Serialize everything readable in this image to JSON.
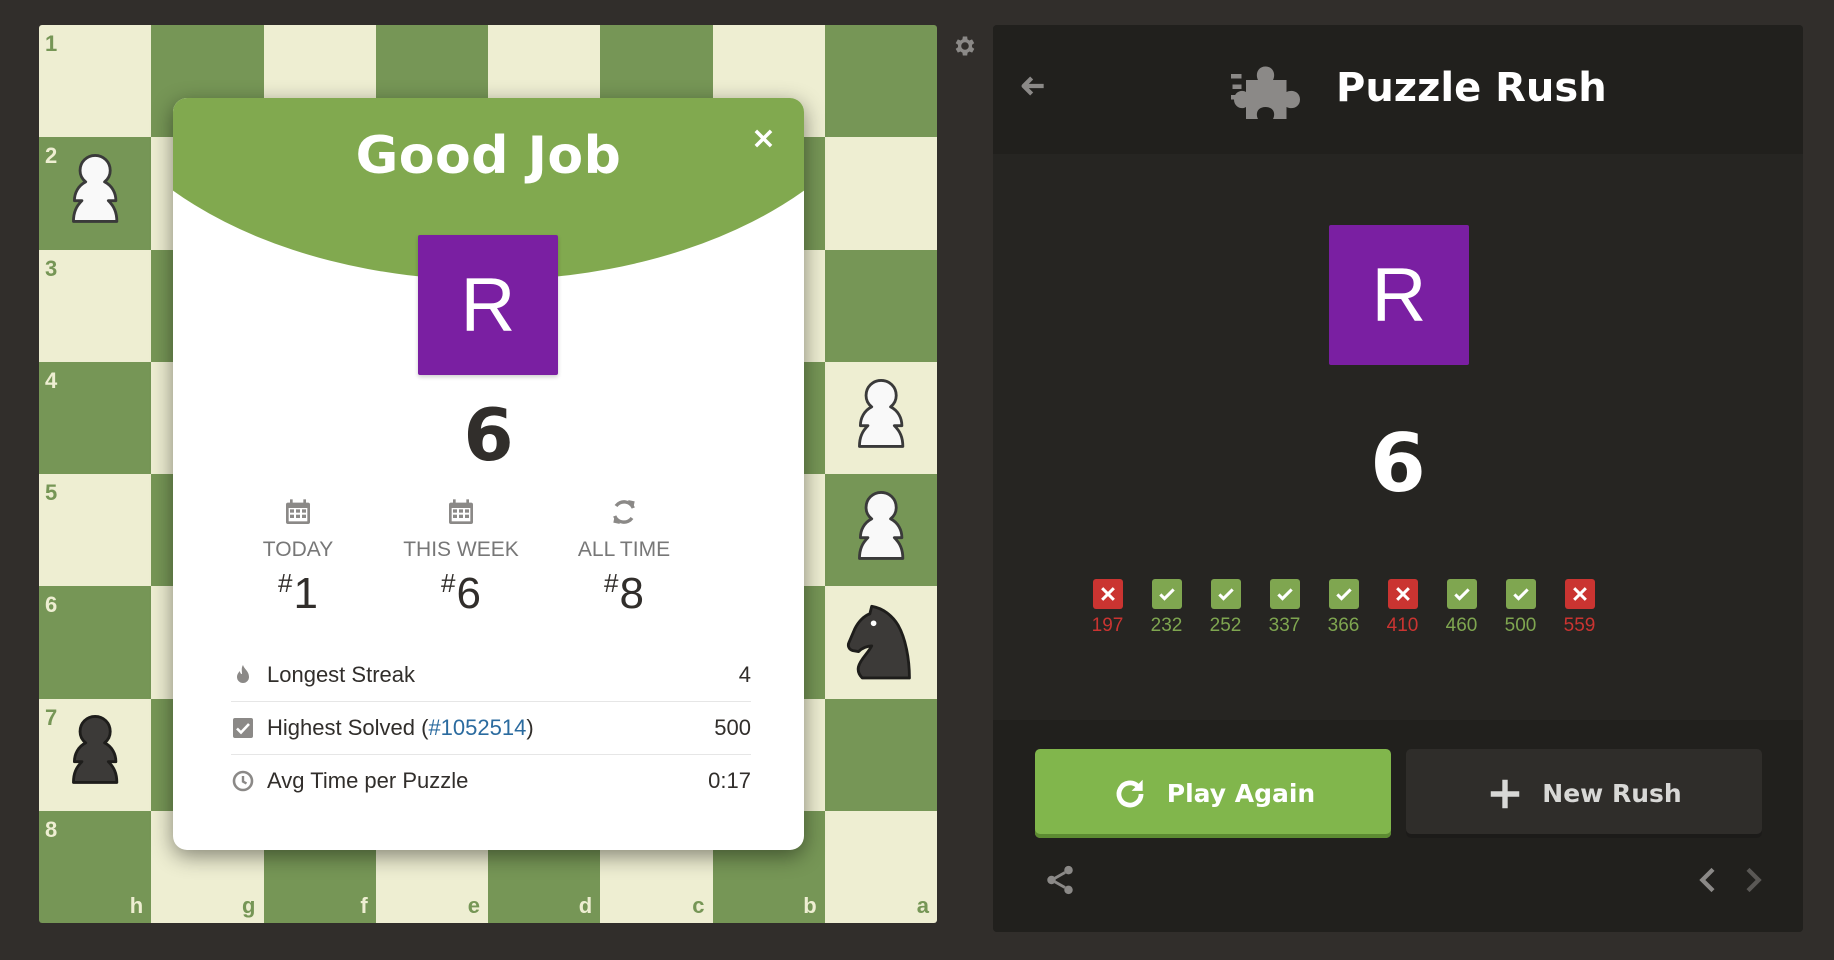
{
  "board": {
    "ranks": [
      "1",
      "2",
      "3",
      "4",
      "5",
      "6",
      "7",
      "8"
    ],
    "files": [
      "h",
      "g",
      "f",
      "e",
      "d",
      "c",
      "b",
      "a"
    ],
    "pieces": [
      {
        "square": "h2",
        "type": "pawn",
        "color": "white"
      },
      {
        "square": "a4",
        "type": "pawn",
        "color": "white"
      },
      {
        "square": "a5",
        "type": "pawn",
        "color": "white"
      },
      {
        "square": "a6",
        "type": "knight",
        "color": "black"
      },
      {
        "square": "h7",
        "type": "pawn",
        "color": "black"
      }
    ]
  },
  "modal": {
    "title": "Good Job",
    "close": "×",
    "avatar_letter": "R",
    "score": "6",
    "ranks": [
      {
        "icon": "calendar-icon",
        "label": "TODAY",
        "value": "1"
      },
      {
        "icon": "calendar-icon",
        "label": "THIS WEEK",
        "value": "6"
      },
      {
        "icon": "refresh-icon",
        "label": "ALL TIME",
        "value": "8"
      }
    ],
    "stats": {
      "longest_streak": {
        "icon": "flame-icon",
        "label": "Longest Streak",
        "value": "4"
      },
      "highest_solved": {
        "icon": "checkbox-icon",
        "label": "Highest Solved",
        "link": "#1052514",
        "value": "500"
      },
      "avg_time": {
        "icon": "clock-icon",
        "label": "Avg Time per Puzzle",
        "value": "0:17"
      }
    }
  },
  "panel": {
    "title": "Puzzle Rush",
    "avatar_letter": "R",
    "score": "6",
    "results": [
      {
        "status": "fail",
        "rating": "197"
      },
      {
        "status": "pass",
        "rating": "232"
      },
      {
        "status": "pass",
        "rating": "252"
      },
      {
        "status": "pass",
        "rating": "337"
      },
      {
        "status": "pass",
        "rating": "366"
      },
      {
        "status": "fail",
        "rating": "410"
      },
      {
        "status": "pass",
        "rating": "460"
      },
      {
        "status": "pass",
        "rating": "500"
      },
      {
        "status": "fail",
        "rating": "559"
      }
    ],
    "play_again_label": "Play Again",
    "new_rush_label": "New Rush"
  },
  "colors": {
    "board_light": "#eeeed2",
    "board_dark": "#769656",
    "modal_header": "#81a94f",
    "avatar": "#7a1fa2",
    "pass": "#7fa650",
    "fail": "#ca3431",
    "play_button": "#81b64c",
    "link": "#2b6b9f"
  }
}
